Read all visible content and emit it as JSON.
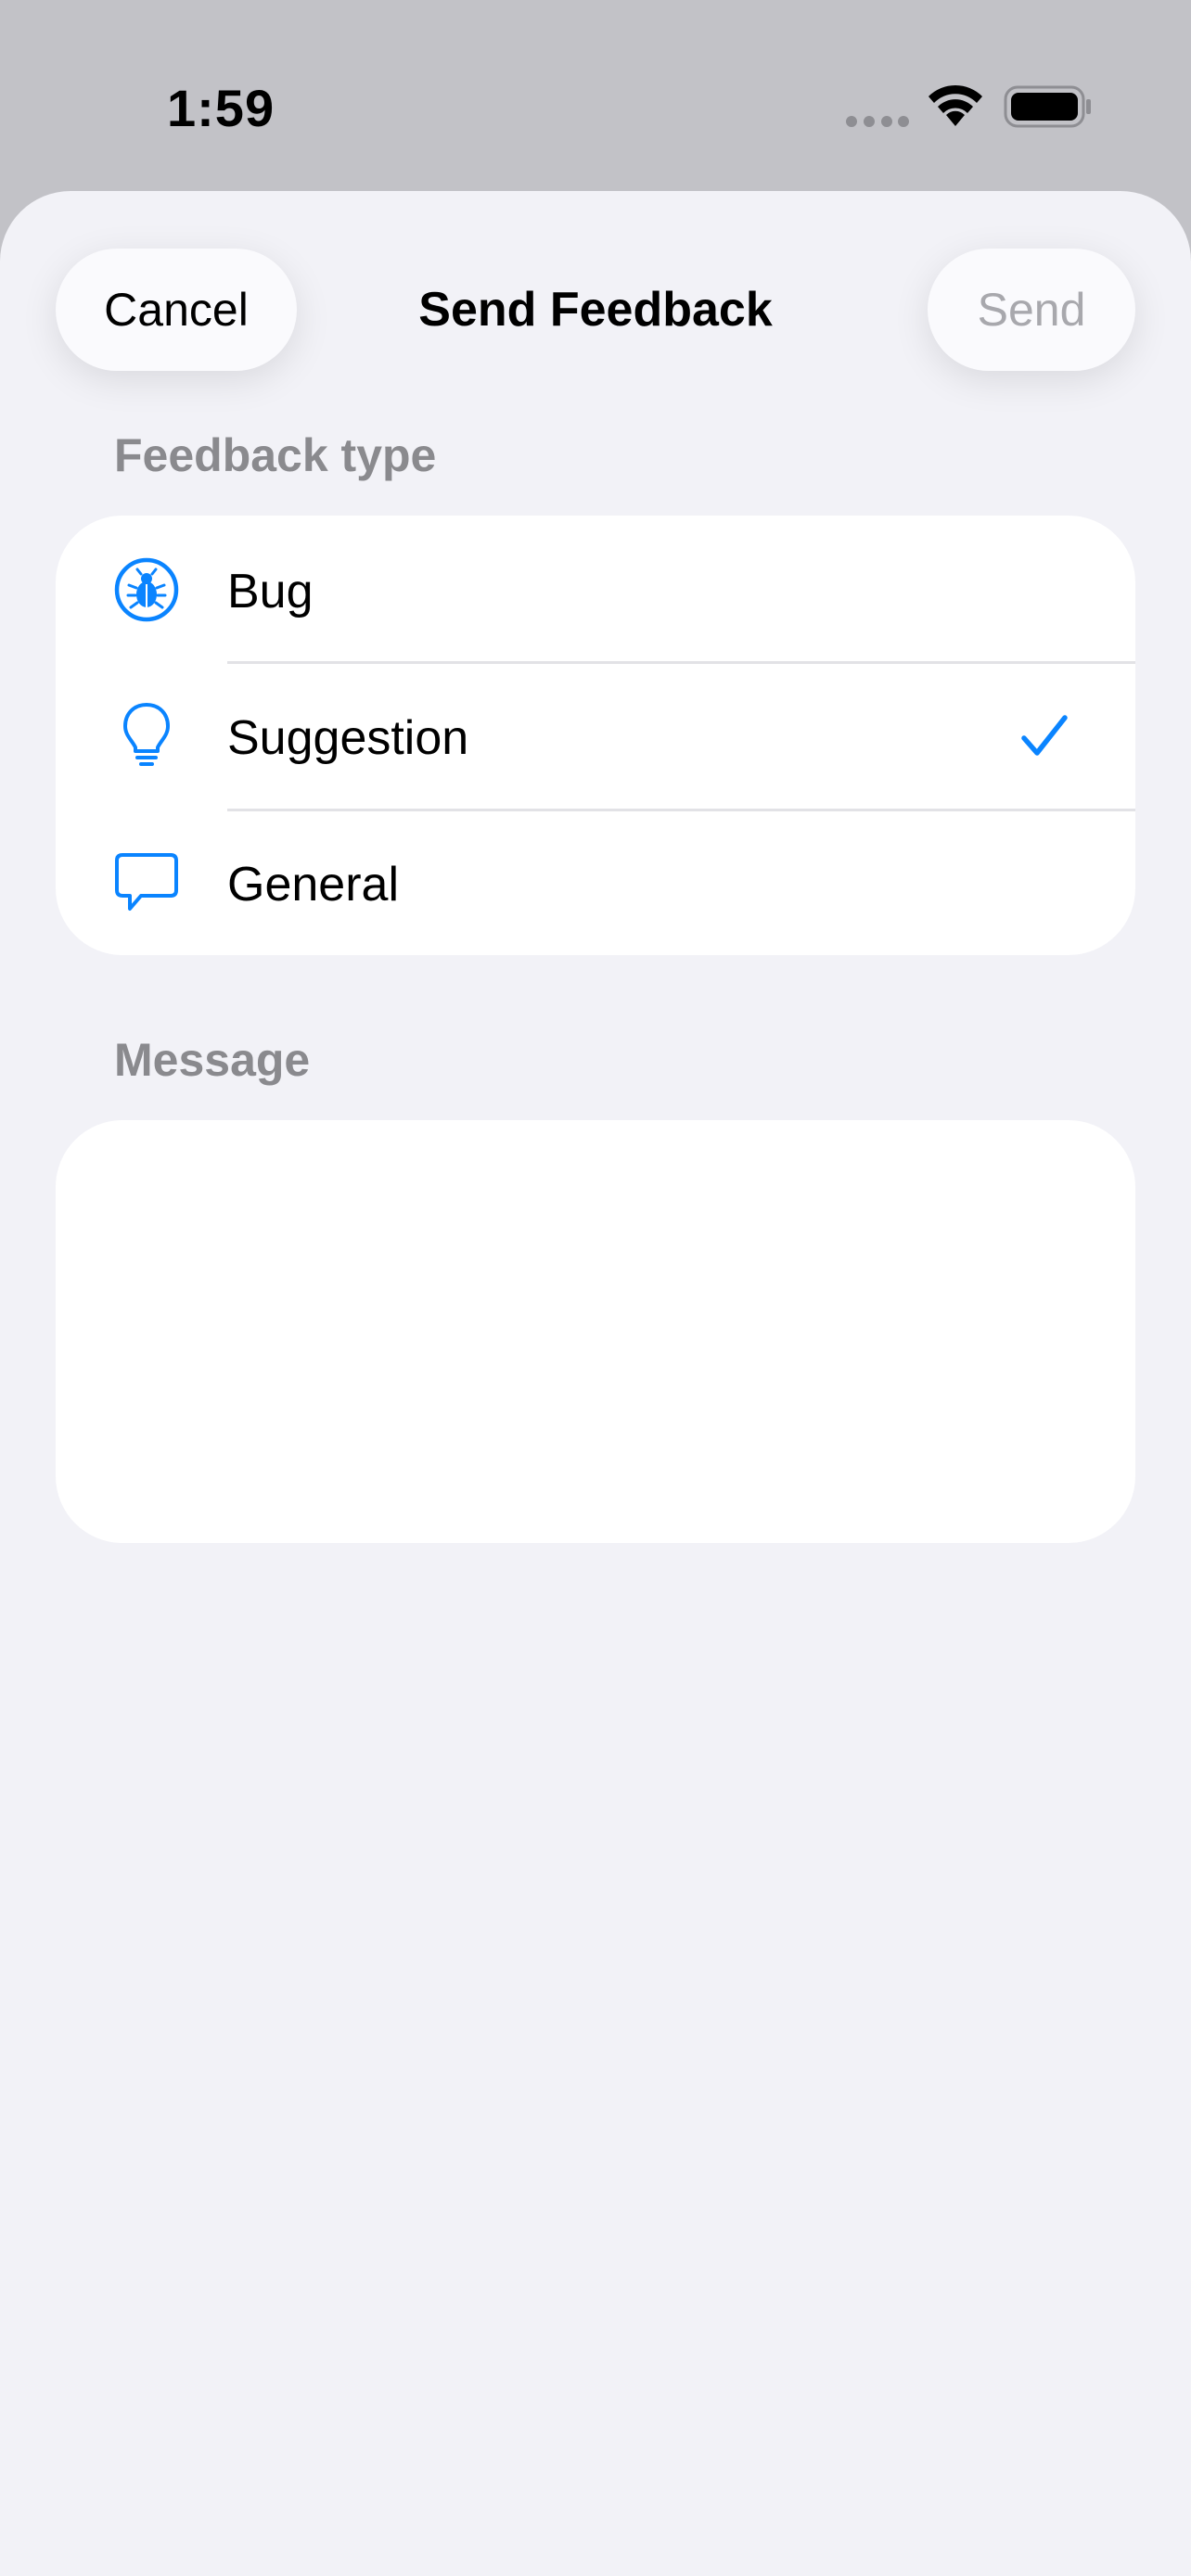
{
  "status_bar": {
    "time": "1:59"
  },
  "nav": {
    "cancel_label": "Cancel",
    "title": "Send Feedback",
    "send_label": "Send"
  },
  "feedback_type": {
    "header": "Feedback type",
    "options": [
      {
        "label": "Bug",
        "icon": "ladybug-icon",
        "selected": false
      },
      {
        "label": "Suggestion",
        "icon": "lightbulb-icon",
        "selected": true
      },
      {
        "label": "General",
        "icon": "speech-bubble-icon",
        "selected": false
      }
    ]
  },
  "message": {
    "header": "Message",
    "value": ""
  },
  "colors": {
    "accent": "#0a84ff",
    "background": "#f2f2f7",
    "card": "#ffffff",
    "secondary_text": "#8a8a8e",
    "disabled_text": "#a8a8ad"
  }
}
